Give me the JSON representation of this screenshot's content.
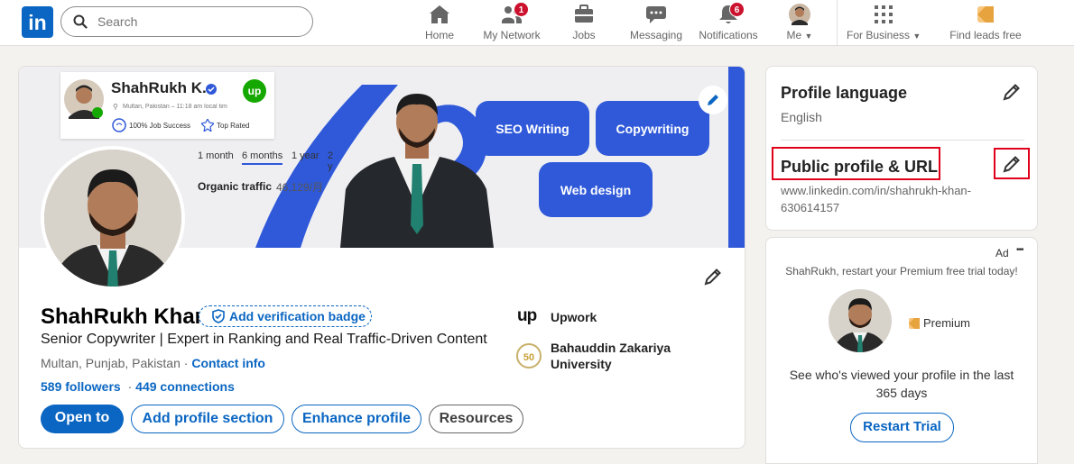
{
  "nav": {
    "logo": "in",
    "search_placeholder": "Search",
    "items": [
      {
        "label": "Home",
        "badge": ""
      },
      {
        "label": "My Network",
        "badge": "1"
      },
      {
        "label": "Jobs",
        "badge": ""
      },
      {
        "label": "Messaging",
        "badge": ""
      },
      {
        "label": "Notifications",
        "badge": "6"
      },
      {
        "label": "Me",
        "badge": ""
      },
      {
        "label": "For Business",
        "badge": ""
      },
      {
        "label": "Find leads free",
        "badge": ""
      }
    ]
  },
  "banner": {
    "upwork_name": "ShahRukh K.",
    "upwork_location": "Multan, Pakistan – 11:18 am local tim",
    "job_success": "100% Job Success",
    "top_rated": "Top Rated",
    "upwork_logo": "up",
    "tabs": [
      "1 month",
      "6 months",
      "1 year",
      "2 y"
    ],
    "traffic_label": "Organic traffic",
    "traffic_value": "46,129/月",
    "services": [
      "SEO Writing",
      "Copywriting",
      "Web design"
    ]
  },
  "profile": {
    "name": "ShahRukh Khan",
    "verify_badge": "Add verification badge",
    "headline": "Senior Copywriter | Expert in Ranking and Real Traffic-Driven Content",
    "location": "Multan, Punjab, Pakistan",
    "location_sep": "·",
    "contact_info": "Contact info",
    "followers": "589 followers",
    "connections_sep": "·",
    "connections": "449 connections",
    "company": "Upwork",
    "school": "Bahauddin Zakariya University",
    "buttons": {
      "open_to": "Open to",
      "add_section": "Add profile section",
      "enhance": "Enhance profile",
      "resources": "Resources"
    }
  },
  "sidebar": {
    "profile_language_title": "Profile language",
    "profile_language_value": "English",
    "public_profile_title": "Public profile & URL",
    "public_profile_url_1": "www.linkedin.com/in/shahrukh-khan-",
    "public_profile_url_2": "630614157"
  },
  "ad": {
    "label": "Ad",
    "more": "•••",
    "headline": "ShahRukh, restart your Premium free trial today!",
    "premium": "Premium",
    "body": "See who's viewed your profile in the last 365 days",
    "cta": "Restart Trial"
  },
  "colors": {
    "brand": "#0a66c2",
    "highlight": "#e0001b",
    "service_pill": "#2f59d9",
    "upwork_green": "#14a800"
  }
}
